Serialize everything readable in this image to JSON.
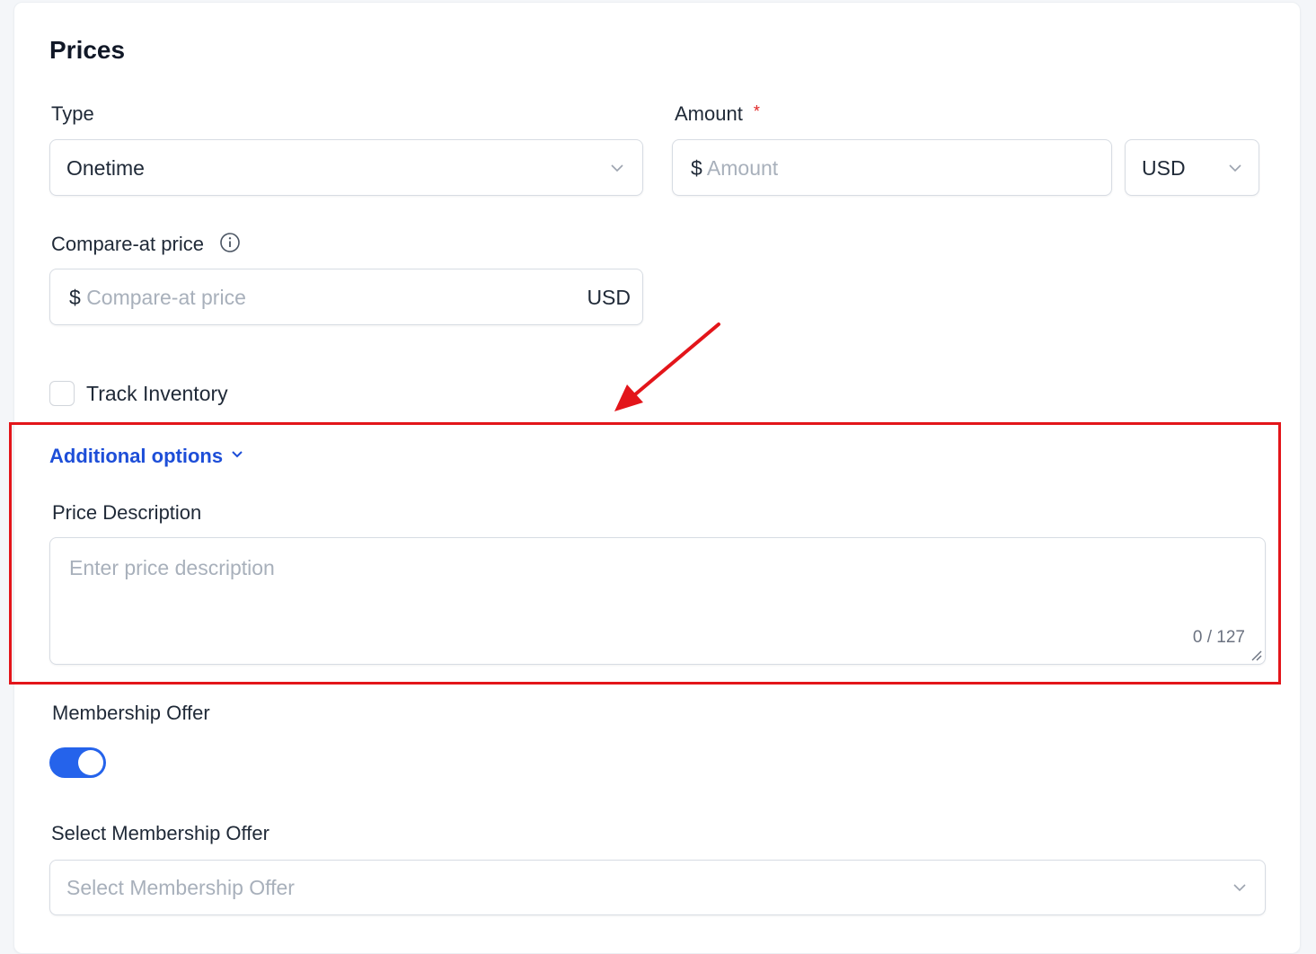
{
  "section": {
    "title": "Prices"
  },
  "type_field": {
    "label": "Type",
    "value": "Onetime"
  },
  "amount_field": {
    "label": "Amount",
    "required_mark": "*",
    "prefix": "$",
    "placeholder": "Amount",
    "currency": "USD"
  },
  "compare_field": {
    "label": "Compare-at price",
    "prefix": "$",
    "placeholder": "Compare-at price",
    "currency": "USD"
  },
  "track_inventory": {
    "label": "Track Inventory",
    "checked": false
  },
  "additional_options": {
    "label": "Additional options"
  },
  "price_description": {
    "label": "Price Description",
    "placeholder": "Enter price description",
    "counter": "0 / 127"
  },
  "membership": {
    "label": "Membership Offer",
    "toggle_on": true,
    "select_label": "Select Membership Offer",
    "select_placeholder": "Select Membership Offer"
  },
  "annotation": {
    "highlight_color": "#e3151a"
  },
  "colors": {
    "accent": "#2563eb",
    "link": "#1d4ed8"
  }
}
